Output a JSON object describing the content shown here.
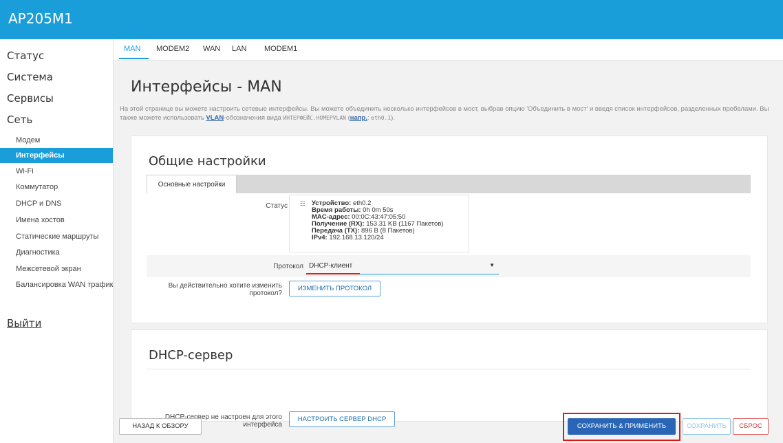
{
  "header": {
    "brand": "AP205M1"
  },
  "sidebar": {
    "top_items": [
      {
        "label": "Статус"
      },
      {
        "label": "Система"
      },
      {
        "label": "Сервисы"
      },
      {
        "label": "Сеть"
      }
    ],
    "sub_items": [
      {
        "label": "Модем"
      },
      {
        "label": "Интерфейсы"
      },
      {
        "label": "Wi-Fi"
      },
      {
        "label": "Коммутатор"
      },
      {
        "label": "DHCP и DNS"
      },
      {
        "label": "Имена хостов"
      },
      {
        "label": "Статические маршруты"
      },
      {
        "label": "Диагностика"
      },
      {
        "label": "Межсетевой экран"
      },
      {
        "label": "Балансировка WAN трафик"
      }
    ],
    "logout": "Выйти"
  },
  "tabs": [
    {
      "label": "MAN"
    },
    {
      "label": "MODEM2"
    },
    {
      "label": "WAN"
    },
    {
      "label": "LAN"
    },
    {
      "label": "MODEM1"
    }
  ],
  "page": {
    "title": "Интерфейсы - MAN",
    "desc_part1": "На этой странице вы можете настроить сетевые интерфейсы. Вы можете объединить несколько интерфейсов в мост, выбрав опцию 'Объединить в мост' и введя список интерфейсов, разделенных пробелами. Вы также можете использовать ",
    "desc_vlan": "VLAN",
    "desc_part2": "-обозначения вида ",
    "desc_mono1": "ИНТЕРФЕЙС.НОМЕРVLAN",
    "desc_part3": " (",
    "desc_example": "напр.",
    "desc_part4": ": ",
    "desc_mono2": "eth0.1",
    "desc_part5": ")."
  },
  "general": {
    "title": "Общие настройки",
    "subtab": "Основные настройки",
    "status_label": "Статус",
    "status": {
      "device_key": "Устройство:",
      "device_val": " eth0.2",
      "uptime_key": "Время работы:",
      "uptime_val": " 0h 0m 50s",
      "mac_key": "MAC-адрес:",
      "mac_val": " 00:0C:43:47:05:50",
      "rx_key": "Получение (RX):",
      "rx_val": " 153.31 KB (1167 Пакетов)",
      "tx_key": "Передача (TX):",
      "tx_val": " 896 B (8 Пакетов)",
      "ipv4_key": "IPv4:",
      "ipv4_val": " 192.168.13.120/24"
    },
    "protocol_label": "Протокол",
    "protocol_value": "DHCP-клиент",
    "change_label": "Вы действительно хотите изменить протокол?",
    "change_button": "ИЗМЕНИТЬ ПРОТОКОЛ"
  },
  "dhcp": {
    "title": "DHCP-сервер",
    "label": "DHCP-сервер не настроен для этого интерфейса",
    "button": "НАСТРОИТЬ СЕРВЕР DHCP"
  },
  "actions": {
    "back": "НАЗАД К ОБЗОРУ",
    "apply": "СОХРАНИТЬ & ПРИМЕНИТЬ",
    "save": "СОХРАНИТЬ",
    "reset": "СБРОС"
  },
  "colors": {
    "accent": "#1a9ed9",
    "apply_button": "#2a66b5",
    "highlight": "#e01818"
  }
}
